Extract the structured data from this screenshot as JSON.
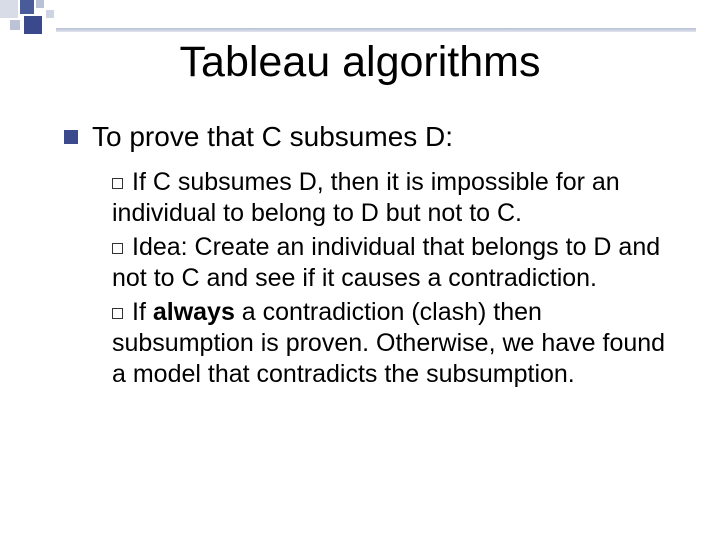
{
  "title": "Tableau algorithms",
  "main_point": "To prove that C subsumes D:",
  "sub_points": [
    {
      "prefix": "If C subsumes D, then it is impossible for an individual to belong to D but not to C."
    },
    {
      "prefix": "Idea: Create an individual that belongs to D and not to C and see if it causes a contradiction."
    },
    {
      "pre": "If ",
      "bold": "always",
      "post": " a contradiction (clash) then subsumption is proven. Otherwise, we have found a model that contradicts the subsumption."
    }
  ]
}
